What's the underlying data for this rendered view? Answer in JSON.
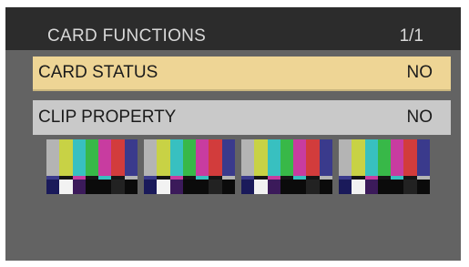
{
  "header": {
    "title": "CARD FUNCTIONS",
    "page": "1/1"
  },
  "menu": {
    "items": [
      {
        "label": "CARD STATUS",
        "value": "NO",
        "selected": true
      },
      {
        "label": "CLIP PROPERTY",
        "value": "NO",
        "selected": false
      }
    ]
  },
  "thumbnails": {
    "count": 4,
    "icon": "color-bars-thumbnail",
    "colors": {
      "bars": [
        "#b4b4b4",
        "#c8d245",
        "#38c0c0",
        "#38b848",
        "#c83ca0",
        "#d23c3c",
        "#3a3a8c"
      ],
      "mid": [
        "#3a3a8c",
        "#151515",
        "#c83ca0",
        "#151515",
        "#38c0c0",
        "#151515",
        "#b4b4b4"
      ],
      "bottom": [
        "#1a1a5a",
        "#f2f2f2",
        "#3b1a5a",
        "#0b0b0b",
        "#0b0b0b",
        "#222222",
        "#0b0b0b"
      ]
    }
  }
}
